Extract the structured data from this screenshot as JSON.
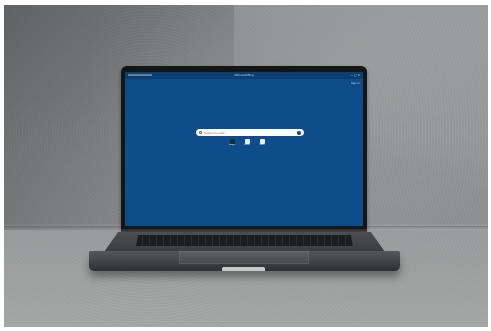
{
  "scene": {
    "wall_color": "#878989",
    "floor_color": "#a2a3a3",
    "laptop_color": "#3f4043"
  },
  "screen": {
    "background_color": "#0f4d8a",
    "app_title": "Microsoft Bing",
    "window_controls": "— ◻ ✕",
    "signin_label": "Sign in",
    "search": {
      "placeholder": "Search the web",
      "icon": "search-icon"
    },
    "shortcuts": [
      {
        "icon": "image-icon",
        "label": "Images"
      },
      {
        "icon": "video-icon",
        "label": "Videos"
      },
      {
        "icon": "news-icon",
        "label": "News"
      }
    ]
  }
}
